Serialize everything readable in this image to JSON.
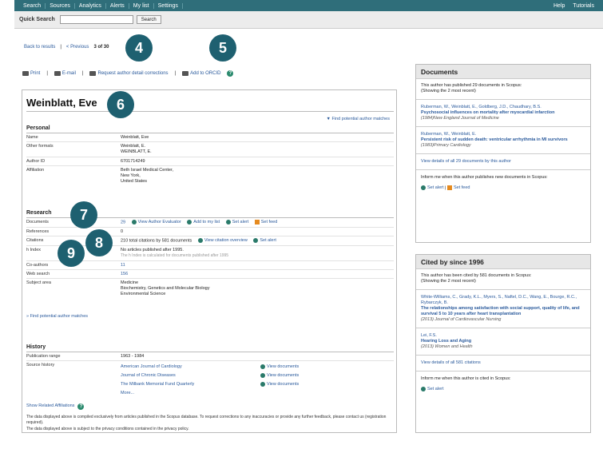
{
  "nav": {
    "items": [
      "Search",
      "Sources",
      "Analytics",
      "Alerts",
      "My list",
      "Settings"
    ],
    "right": [
      "Help",
      "Tutorials"
    ]
  },
  "quick_search": {
    "label": "Quick Search",
    "button": "Search"
  },
  "breadcrumb": {
    "back": "Back to results",
    "previous": "< Previous",
    "position": "3 of 30"
  },
  "toolbar": {
    "print": "Print",
    "email": "E-mail",
    "request": "Request author detail corrections",
    "add": "Add to ORCID"
  },
  "callouts": [
    "4",
    "5",
    "6",
    "7",
    "8",
    "9"
  ],
  "author": {
    "name": "Weinblatt, Eve",
    "find_matches": "Find potential author matches",
    "personal_header": "Personal",
    "name_label": "Name",
    "name_value": "Weinblatt, Eve",
    "other_formats_label": "Other formats",
    "other_formats": [
      "Weinblatt, E.",
      "WEINBLATT, E."
    ],
    "author_id_label": "Author ID",
    "author_id": "6701714249",
    "affiliation_label": "Affiliation",
    "affiliation": [
      "Beth Israel Medical Center,",
      "New York,",
      "United States"
    ]
  },
  "research": {
    "header": "Research",
    "documents_label": "Documents",
    "documents_count": "29",
    "doc_actions": [
      "View Author Evaluator",
      "Add to my list",
      "Set alert",
      "Set feed"
    ],
    "references_label": "References",
    "references": "0",
    "citations_label": "Citations",
    "citations_text": "210 total citations by 581 documents",
    "citation_actions": [
      "View citation overview",
      "Set alert"
    ],
    "hindex_label": "h Index",
    "hindex": "No articles published after 1995.",
    "hindex_note": "The h Index is calculated for documents published after 1995",
    "coauthors_label": "Co-authors",
    "coauthors": "11",
    "web_search_label": "Web search",
    "web_search": "156",
    "subject_label": "Subject area",
    "subjects": [
      "Medicine",
      "Biochemistry, Genetics and Molecular Biology",
      "Environmental Science"
    ],
    "find_matches": "Find potential author matches"
  },
  "history": {
    "header": "History",
    "pub_range_label": "Publication range",
    "pub_range": "1963 - 1984",
    "source_label": "Source history",
    "sources": [
      "American Journal of Cardiology",
      "Journal of Chronic Diseases",
      "The Milbank Memorial Fund Quarterly"
    ],
    "view_docs": "View documents",
    "more": "More...",
    "show_affiliations": "Show Related Affiliations"
  },
  "footnotes": [
    "The data displayed above is compiled exclusively from articles published in the Scopus database. To request corrections to any inaccuracies or provide any further feedback, please contact us (registration required).",
    "The data displayed above is subject to the privacy conditions contained in the privacy policy."
  ],
  "documents_box": {
    "title": "Documents",
    "intro": "This author has published 29 documents in Scopus:",
    "showing": "(Showing the 2 most recent)",
    "items": [
      {
        "authors": "Ruberman, W., Weinblatt, E., Goldberg, J.D., Chaudhary, B.S.",
        "title": "Psychosocial influences on mortality after myocardial infarction",
        "source": "(1984)New England Journal of Medicine"
      },
      {
        "authors": "Ruberman, W., Weinblatt, E.",
        "title": "Persistent risk of sudden death: ventricular arrhythmia in MI survivors",
        "source": "(1983)Primary Cardiology"
      }
    ],
    "view_all": "View details of all 29 documents by this author",
    "inform": "Inform me when this author publishes new documents in Scopus:",
    "actions": [
      "Set alert",
      "Set feed"
    ]
  },
  "cited_box": {
    "title": "Cited by since 1996",
    "intro": "This author has been cited by 581 documents in Scopus:",
    "showing": "(Showing the 2 most recent)",
    "items": [
      {
        "authors": "White-Williams, C., Grady, K.L., Myers, S., Naftel, D.C., Wang, E., Bourge, R.C., Rybarczyk, B.",
        "title": "The relationships among satisfaction with social support, quality of life, and survival 5 to 10 years after heart transplantation",
        "source": "(2013) Journal of Cardiovascular Nursing"
      },
      {
        "authors": "Lei, F.S.",
        "title": "Hearing Loss and Aging",
        "source": "(2013) Women and Health"
      }
    ],
    "view_all": "View details of all 581 citations",
    "inform": "Inform me when this author is cited in Scopus:",
    "action": "Set alert"
  }
}
